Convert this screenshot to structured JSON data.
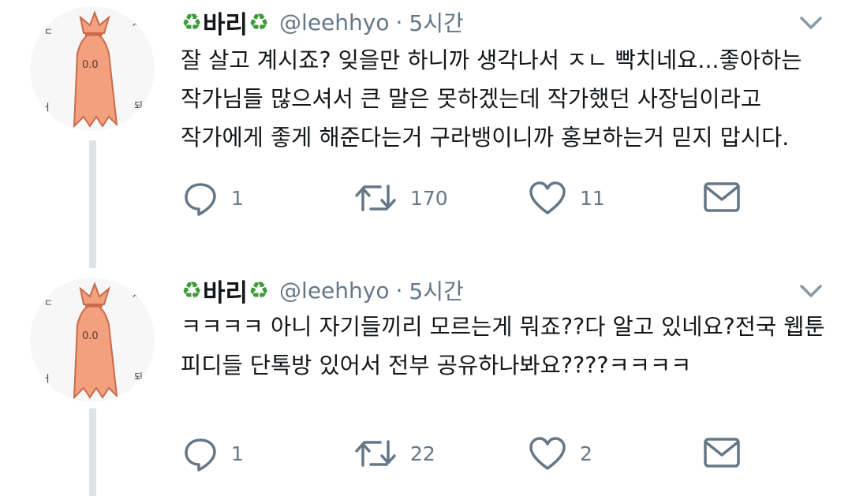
{
  "tweets": [
    {
      "display_name": "바리",
      "handle": "@leehhyo",
      "separator": "·",
      "time": "5시간",
      "text": "잘 살고 계시죠? 잊을만 하니까 생각나서 ㅈㄴ 빡치네요...좋아하는\n작가님들 많으셔서 큰 말은 못하겠는데 작가했던 사장님이라고\n작가에게 좋게 해준다는거 구라뱅이니까 홍보하는거 믿지 맙시다.",
      "replies": "1",
      "retweets": "170",
      "likes": "11"
    },
    {
      "display_name": "바리",
      "handle": "@leehhyo",
      "separator": "·",
      "time": "5시간",
      "text": "ㅋㅋㅋㅋ 아니 자기들끼리 모르는게 뭐죠??다 알고 있네요?전국 웹툰\n피디들 단톡방 있어서 전부 공유하나봐요????ㅋㅋㅋㅋ",
      "replies": "1",
      "retweets": "22",
      "likes": "2"
    }
  ],
  "icons": {
    "name_decoration": "recycle-icon",
    "more": "chevron-down-icon",
    "reply": "reply-icon",
    "retweet": "retweet-icon",
    "like": "heart-icon",
    "dm": "envelope-icon"
  },
  "colors": {
    "text": "#14171a",
    "secondary": "#657786",
    "recycle": "#3d9b3a",
    "thread_line": "#dde3e8",
    "avatar_ghost": "#f2a07e"
  }
}
